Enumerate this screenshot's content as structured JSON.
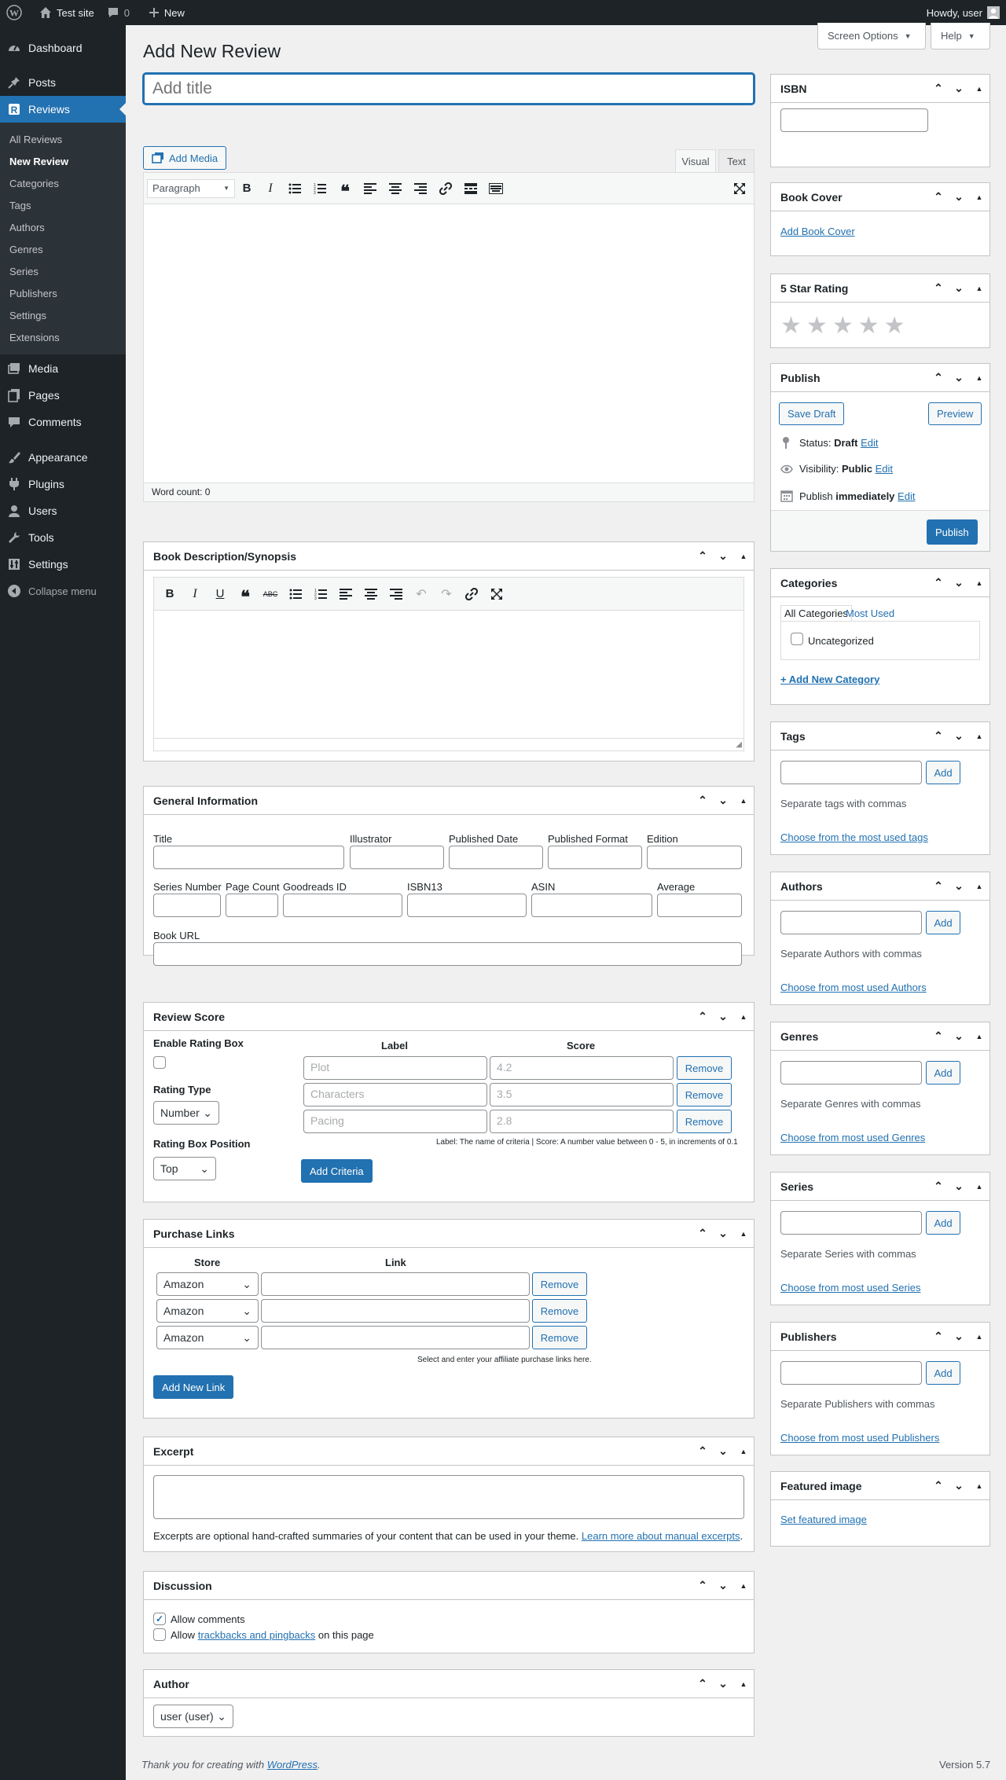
{
  "adminbar": {
    "site": "Test site",
    "comments": "0",
    "new": "New",
    "howdy": "Howdy, user"
  },
  "sidebar": {
    "items": [
      {
        "label": "Dashboard"
      },
      {
        "label": "Posts"
      },
      {
        "label": "Reviews"
      },
      {
        "label": "Media"
      },
      {
        "label": "Pages"
      },
      {
        "label": "Comments"
      },
      {
        "label": "Appearance"
      },
      {
        "label": "Plugins"
      },
      {
        "label": "Users"
      },
      {
        "label": "Tools"
      },
      {
        "label": "Settings"
      },
      {
        "label": "Collapse menu"
      }
    ],
    "submenu": [
      "All Reviews",
      "New Review",
      "Categories",
      "Tags",
      "Authors",
      "Genres",
      "Series",
      "Publishers",
      "Settings",
      "Extensions"
    ]
  },
  "header": {
    "title": "Add New Review",
    "screen_options": "Screen Options",
    "help": "Help"
  },
  "editor": {
    "title_placeholder": "Add title",
    "add_media": "Add Media",
    "tab_visual": "Visual",
    "tab_text": "Text",
    "format": "Paragraph",
    "word_count": "Word count: 0"
  },
  "desc_box": {
    "title": "Book Description/Synopsis"
  },
  "general": {
    "title": "General Information",
    "fields": [
      "Title",
      "Illustrator",
      "Published Date",
      "Published Format",
      "Edition",
      "Series Number",
      "Page Count",
      "Goodreads ID",
      "ISBN13",
      "ASIN",
      "Average",
      "Book URL"
    ]
  },
  "review_score": {
    "title": "Review Score",
    "enable_label": "Enable Rating Box",
    "rating_type_label": "Rating Type",
    "rating_type_value": "Number",
    "position_label": "Rating Box Position",
    "position_value": "Top",
    "col_label": "Label",
    "col_score": "Score",
    "rows": [
      {
        "label": "Plot",
        "score": "4.2",
        "remove": "Remove"
      },
      {
        "label": "Characters",
        "score": "3.5",
        "remove": "Remove"
      },
      {
        "label": "Pacing",
        "score": "2.8",
        "remove": "Remove"
      }
    ],
    "note": "Label: The name of criteria | Score: A number value between 0 - 5, in increments of 0.1",
    "add_criteria": "Add Criteria"
  },
  "purchase": {
    "title": "Purchase Links",
    "col_store": "Store",
    "col_link": "Link",
    "rows": [
      {
        "store": "Amazon",
        "remove": "Remove"
      },
      {
        "store": "Amazon",
        "remove": "Remove"
      },
      {
        "store": "Amazon",
        "remove": "Remove"
      }
    ],
    "note": "Select and enter your affiliate purchase links here.",
    "add_new": "Add New Link"
  },
  "excerpt": {
    "title": "Excerpt",
    "help": "Excerpts are optional hand-crafted summaries of your content that can be used in your theme.",
    "learn_more": "Learn more about manual excerpts",
    "dot": "."
  },
  "discussion": {
    "title": "Discussion",
    "allow_comments": "Allow comments",
    "allow": "Allow",
    "trackbacks": "trackbacks and pingbacks",
    "on_page": "on this page"
  },
  "author": {
    "title": "Author",
    "value": "user (user)"
  },
  "isbn": {
    "title": "ISBN"
  },
  "cover": {
    "title": "Book Cover",
    "link": "Add Book Cover"
  },
  "rating": {
    "title": "5 Star Rating",
    "stars": 0
  },
  "publish": {
    "title": "Publish",
    "save_draft": "Save Draft",
    "preview": "Preview",
    "status_label": "Status:",
    "status_value": "Draft",
    "visibility_label": "Visibility:",
    "visibility_value": "Public",
    "publish_label": "Publish",
    "publish_value": "immediately",
    "edit": "Edit",
    "publish_btn": "Publish"
  },
  "categories": {
    "title": "Categories",
    "tab_all": "All Categories",
    "tab_used": "Most Used",
    "item": "Uncategorized",
    "add": "+ Add New Category"
  },
  "taxonomies": [
    {
      "title": "Tags",
      "add": "Add",
      "desc": "Separate tags with commas",
      "link": "Choose from the most used tags"
    },
    {
      "title": "Authors",
      "add": "Add",
      "desc": "Separate Authors with commas",
      "link": "Choose from most used Authors"
    },
    {
      "title": "Genres",
      "add": "Add",
      "desc": "Separate Genres with commas",
      "link": "Choose from most used Genres"
    },
    {
      "title": "Series",
      "add": "Add",
      "desc": "Separate Series with commas",
      "link": "Choose from most used Series"
    },
    {
      "title": "Publishers",
      "add": "Add",
      "desc": "Separate Publishers with commas",
      "link": "Choose from most used Publishers"
    }
  ],
  "featured": {
    "title": "Featured image",
    "link": "Set featured image"
  },
  "footer": {
    "thanks": "Thank you for creating with",
    "wp": "WordPress",
    "dot": ".",
    "version": "Version 5.7"
  },
  "colors": {
    "accent": "#2271b1",
    "adminbar": "#1d2327",
    "submenu": "#2c3338"
  }
}
